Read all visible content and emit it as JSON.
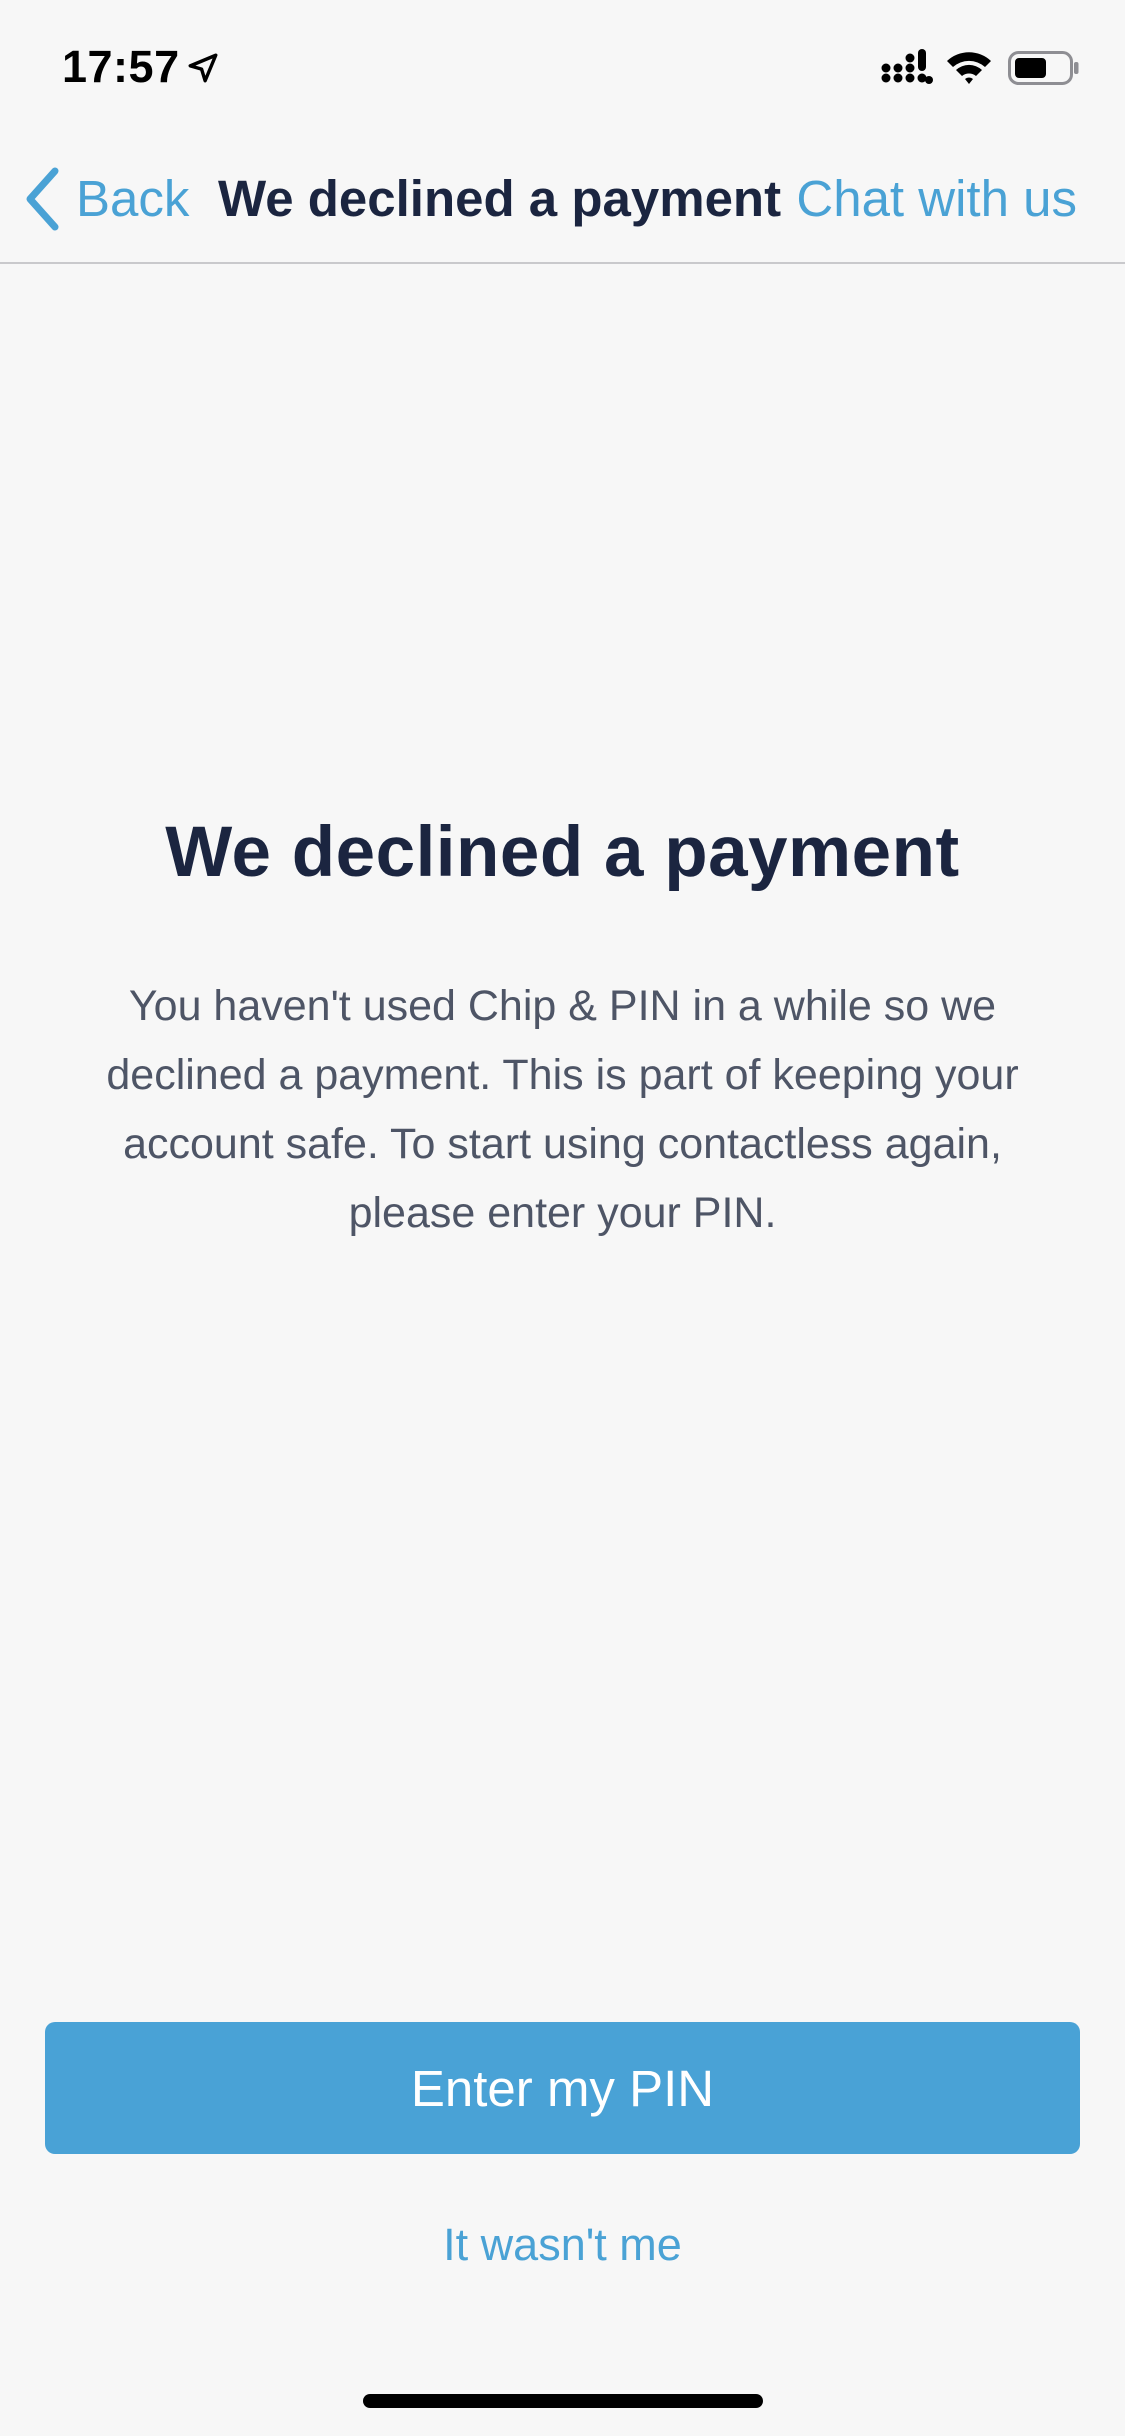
{
  "status_bar": {
    "time": "17:57",
    "icons": [
      "location-arrow-icon",
      "cellular-signal-icon",
      "wifi-icon",
      "battery-icon"
    ]
  },
  "nav": {
    "back_label": "Back",
    "title": "We declined a payment",
    "chat_label": "Chat with us"
  },
  "content": {
    "heading": "We declined a payment",
    "body": "You haven't used Chip & PIN in a while so we declined a payment. This is part of keeping your account safe. To start using contactless again, please enter your PIN."
  },
  "actions": {
    "primary_label": "Enter my PIN",
    "secondary_label": "It wasn't me"
  },
  "colors": {
    "accent": "#4aa2d5",
    "button_background": "#49a2d6",
    "heading_text": "#1b2540",
    "body_text": "#4e5566",
    "background": "#f7f7f7"
  }
}
